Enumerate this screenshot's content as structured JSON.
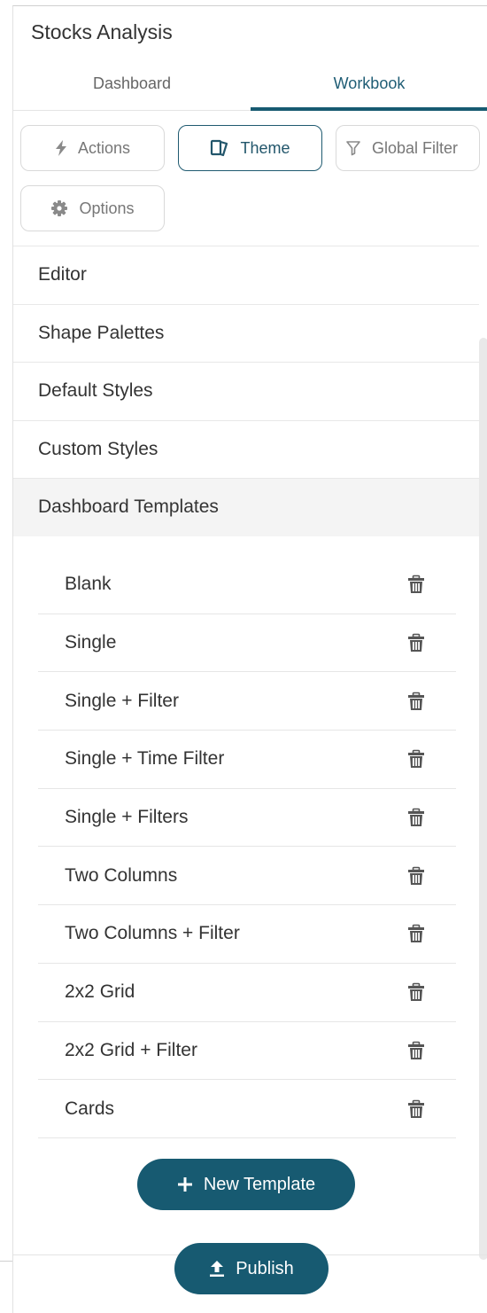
{
  "header": {
    "title": "Stocks Analysis"
  },
  "tabs": [
    {
      "label": "Dashboard"
    },
    {
      "label": "Workbook"
    }
  ],
  "toolbar": {
    "actions": "Actions",
    "theme": "Theme",
    "global_filter": "Global Filter",
    "options": "Options"
  },
  "sections": [
    {
      "label": "Editor"
    },
    {
      "label": "Shape Palettes"
    },
    {
      "label": "Default Styles"
    },
    {
      "label": "Custom Styles"
    },
    {
      "label": "Dashboard Templates"
    }
  ],
  "templates": [
    {
      "name": "Blank"
    },
    {
      "name": "Single"
    },
    {
      "name": "Single + Filter"
    },
    {
      "name": "Single + Time Filter"
    },
    {
      "name": "Single + Filters"
    },
    {
      "name": "Two Columns"
    },
    {
      "name": "Two Columns + Filter"
    },
    {
      "name": "2x2 Grid"
    },
    {
      "name": "2x2 Grid + Filter"
    },
    {
      "name": "Cards"
    }
  ],
  "actions": {
    "new_template": "New Template",
    "publish": "Publish"
  },
  "colors": {
    "accent": "#175a71",
    "selected_section_bg": "#f4f4f4"
  }
}
